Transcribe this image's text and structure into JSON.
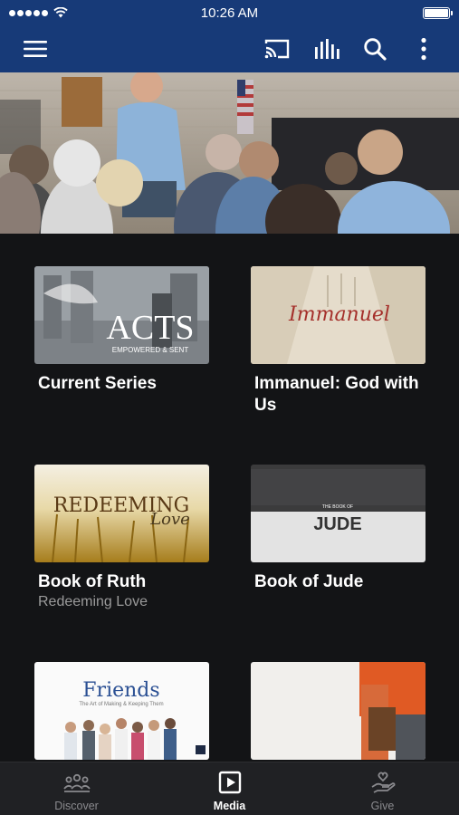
{
  "status_bar": {
    "time": "10:26 AM"
  },
  "toolbar": {
    "menu_icon": "menu-icon",
    "cast_icon": "cast-icon",
    "audio_icon": "audio-bars-icon",
    "search_icon": "search-icon",
    "more_icon": "more-vertical-icon"
  },
  "hero": {
    "description_icon": "sermon-hero-image"
  },
  "series": [
    {
      "thumb_text": "ACTS",
      "thumb_sub": "EMPOWERED & SENT",
      "title": "Current Series",
      "subtitle": ""
    },
    {
      "thumb_text": "Immanuel",
      "thumb_sub": "",
      "title": "Immanuel: God with Us",
      "subtitle": ""
    },
    {
      "thumb_text": "REDEEMING",
      "thumb_sub": "Love",
      "title": "Book of Ruth",
      "subtitle": "Redeeming Love"
    },
    {
      "thumb_text": "JUDE",
      "thumb_sub": "THE BOOK OF",
      "title": "Book of Jude",
      "subtitle": ""
    },
    {
      "thumb_text": "Friends",
      "thumb_sub": "The Art of Making & Keeping Them",
      "title": "",
      "subtitle": ""
    },
    {
      "thumb_text": "",
      "thumb_sub": "",
      "title": "",
      "subtitle": ""
    }
  ],
  "tabs": [
    {
      "label": "Discover",
      "icon": "people-icon",
      "active": false
    },
    {
      "label": "Media",
      "icon": "play-icon",
      "active": true
    },
    {
      "label": "Give",
      "icon": "giving-hand-icon",
      "active": false
    }
  ],
  "colors": {
    "header": "#173a78",
    "background": "#131416",
    "tabbar": "#202124"
  }
}
